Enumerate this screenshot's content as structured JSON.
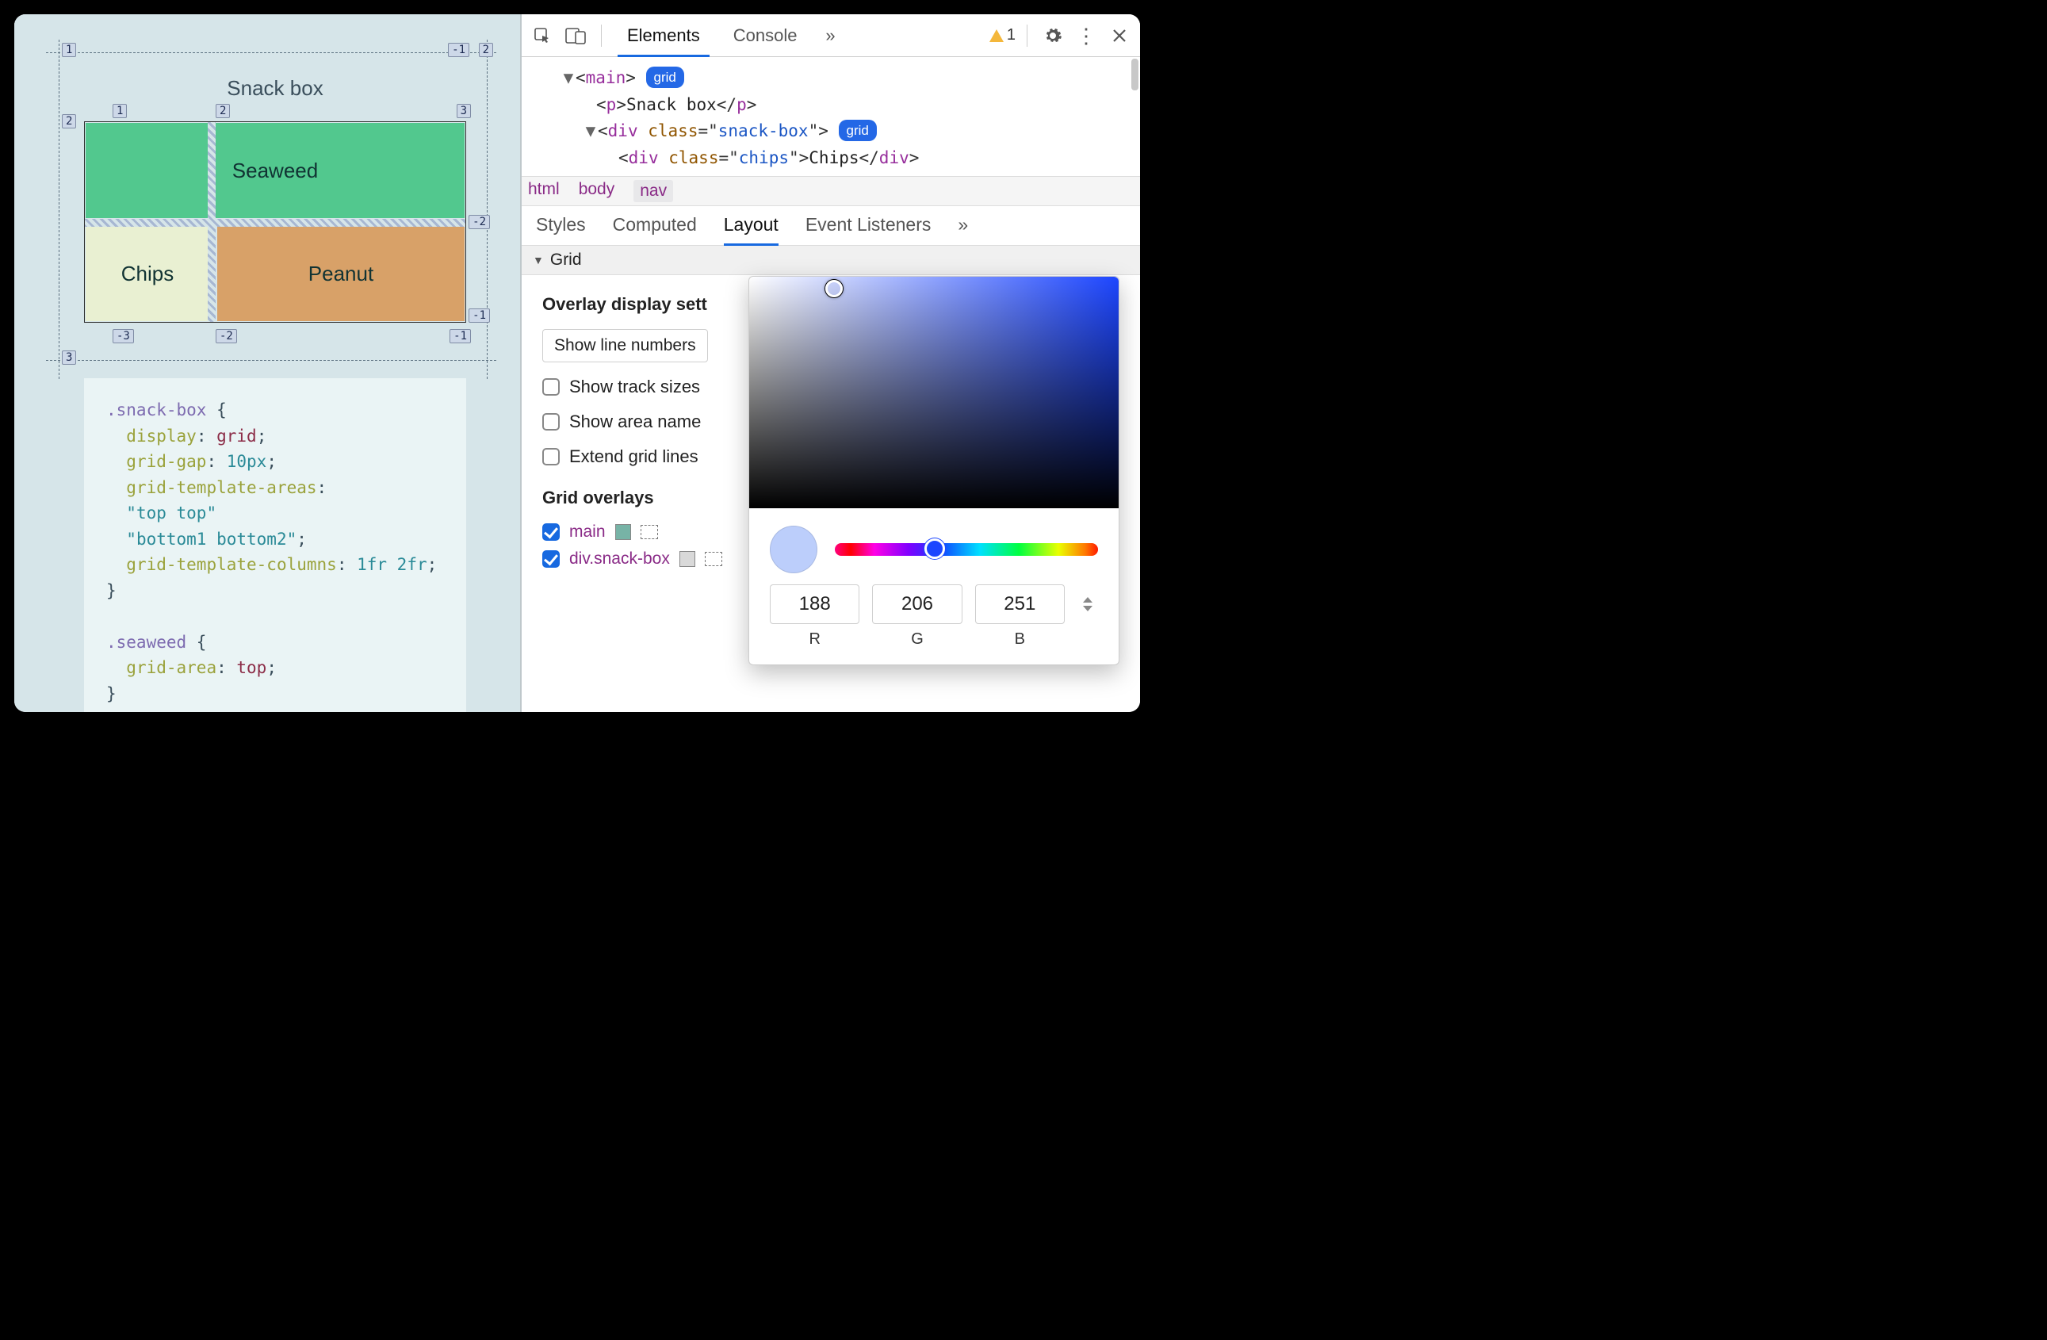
{
  "viewport": {
    "title": "Snack box",
    "cells": {
      "seaweed": "Seaweed",
      "chips": "Chips",
      "peanut": "Peanut"
    },
    "grid_labels": {
      "outer_top_left": "1",
      "outer_top_right": "-1",
      "outer_top_right2": "2",
      "outer_left_row2": "2",
      "outer_left_bottom": "3",
      "row_top_1": "1",
      "row_top_2": "2",
      "row_top_3": "3",
      "row_mid_left_2": "2",
      "row_mid_right_neg2": "-2",
      "row_bot_left_3": "3",
      "row_bot_neg3": "-3",
      "row_bot_neg2": "-2",
      "row_bot_right_neg1": "-1",
      "row_bot_right_neg1b": "-1"
    },
    "code": {
      "l1_sel": ".snack-box",
      "l1_open": " {",
      "l2_prop": "display",
      "l2_val": "grid",
      "l3_prop": "grid-gap",
      "l3_val": "10px",
      "l4_prop": "grid-template-areas",
      "l4_colon": ":",
      "l5_val": "\"top top\"",
      "l6_val": "\"bottom1 bottom2\"",
      "l7_prop": "grid-template-columns",
      "l7_val": "1fr 2fr",
      "l8_close": "}",
      "l10_sel": ".seaweed",
      "l10_open": " {",
      "l11_prop": "grid-area",
      "l11_val": "top",
      "l12_close": "}"
    }
  },
  "devtools": {
    "tabs": {
      "elements": "Elements",
      "console": "Console"
    },
    "warn_count": "1",
    "dom": {
      "l1_tag": "main",
      "l1_badge": "grid",
      "l2_tag": "p",
      "l2_text": "Snack box",
      "l3_tag": "div",
      "l3_attr": "class",
      "l3_val": "snack-box",
      "l3_badge": "grid",
      "l4_tag": "div",
      "l4_attr": "class",
      "l4_val": "chips",
      "l4_text": "Chips"
    },
    "crumbs": {
      "c1": "html",
      "c2": "body",
      "c3": "nav"
    },
    "style_tabs": {
      "t1": "Styles",
      "t2": "Computed",
      "t3": "Layout",
      "t4": "Event Listeners"
    },
    "section_title": "Grid",
    "layout": {
      "heading1": "Overlay display sett",
      "select_label": "Show line numbers",
      "chk1": "Show track sizes",
      "chk2": "Show area name",
      "chk3": "Extend grid lines",
      "heading2": "Grid overlays",
      "ov1": "main",
      "ov2": "div.snack-box"
    },
    "picker": {
      "r": "188",
      "g": "206",
      "b": "251",
      "r_label": "R",
      "g_label": "G",
      "b_label": "B"
    }
  }
}
